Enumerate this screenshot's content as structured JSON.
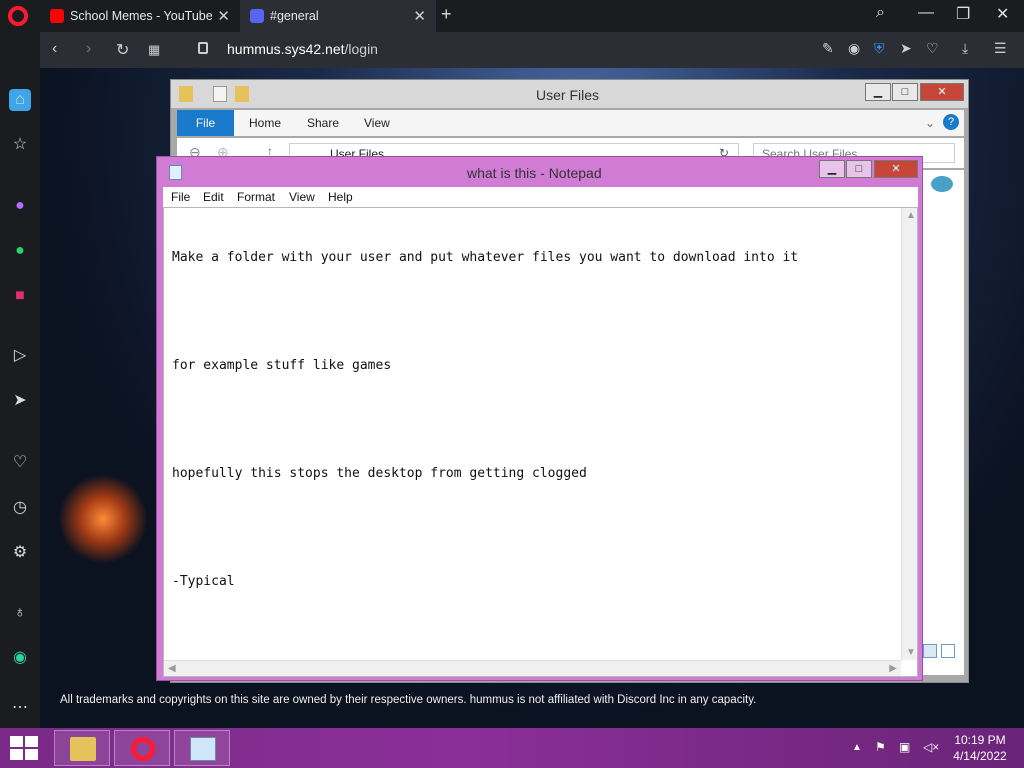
{
  "browser": {
    "tabs": [
      {
        "title": "School Memes - YouTube"
      },
      {
        "title": "#general"
      }
    ],
    "url_host": "hummus.sys42.net",
    "url_path": "/login"
  },
  "site": {
    "footer": "All trademarks and copyrights on this site are owned by their respective owners. hummus is not affiliated with Discord Inc in any capacity."
  },
  "explorer": {
    "title": "User Files",
    "ribbon": {
      "file": "File",
      "home": "Home",
      "share": "Share",
      "view": "View"
    },
    "path": "User Files",
    "search_placeholder": "Search User Files"
  },
  "notepad": {
    "title": "what is this - Notepad",
    "menu": [
      "File",
      "Edit",
      "Format",
      "View",
      "Help"
    ],
    "lines": [
      "Make a folder with your user and put whatever files you want to download into it",
      "",
      "for example stuff like games",
      "",
      "hopefully this stops the desktop from getting clogged",
      "",
      "-Typical"
    ]
  },
  "taskbar": {
    "time": "10:19 PM",
    "date": "4/14/2022"
  },
  "colors": {
    "opera_red": "#ff1b2d",
    "taskbar_purple": "#8a2f98",
    "notepad_frame": "#d07cd4",
    "ribbon_blue": "#1979ca"
  }
}
